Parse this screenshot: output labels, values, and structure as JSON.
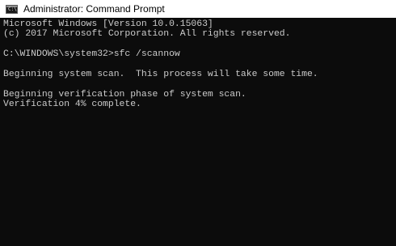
{
  "window": {
    "title": "Administrator: Command Prompt",
    "icon": "command-prompt-icon",
    "icon_glyph": "C:\\"
  },
  "console": {
    "background": "#0c0c0c",
    "foreground": "#cccccc",
    "lines": [
      "Microsoft Windows [Version 10.0.15063]",
      "(c) 2017 Microsoft Corporation. All rights reserved.",
      "",
      "C:\\WINDOWS\\system32>sfc /scannow",
      "",
      "Beginning system scan.  This process will take some time.",
      "",
      "Beginning verification phase of system scan.",
      "Verification 4% complete."
    ]
  }
}
